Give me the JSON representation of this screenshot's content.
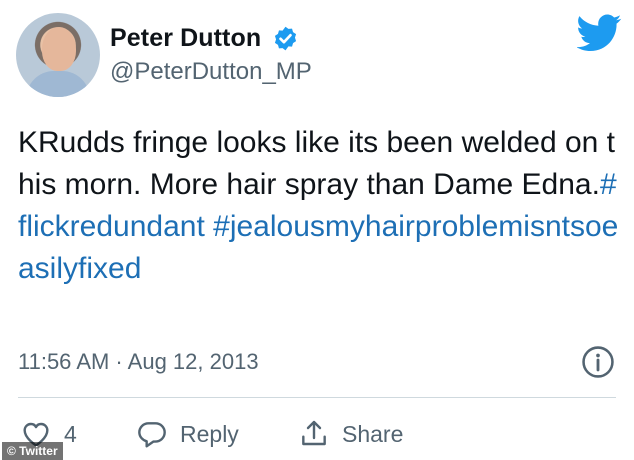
{
  "author": {
    "name": "Peter Dutton",
    "handle": "@PeterDutton_MP",
    "verified": true
  },
  "tweet": {
    "text": "KRudds fringe looks like its been welded on this morn. More hair spray than Dame Edna.",
    "hashtags": [
      "#flickredundant",
      "#jealousmyhairproblemisntsoeasilyfixed"
    ],
    "timestamp": "11:56 AM · Aug 12, 2013"
  },
  "actions": {
    "like_count": "4",
    "reply_label": "Reply",
    "share_label": "Share"
  },
  "credit": "© Twitter",
  "icons": {
    "verified": "verified-badge-icon",
    "logo": "twitter-bird-icon",
    "info": "info-icon",
    "like": "heart-icon",
    "reply": "speech-bubble-icon",
    "share": "share-icon"
  },
  "colors": {
    "twitter_blue": "#1d9bf0",
    "hashtag_blue": "#1d6fb5",
    "text": "#0f1419",
    "secondary": "#536471",
    "divider": "#cfd9de"
  }
}
